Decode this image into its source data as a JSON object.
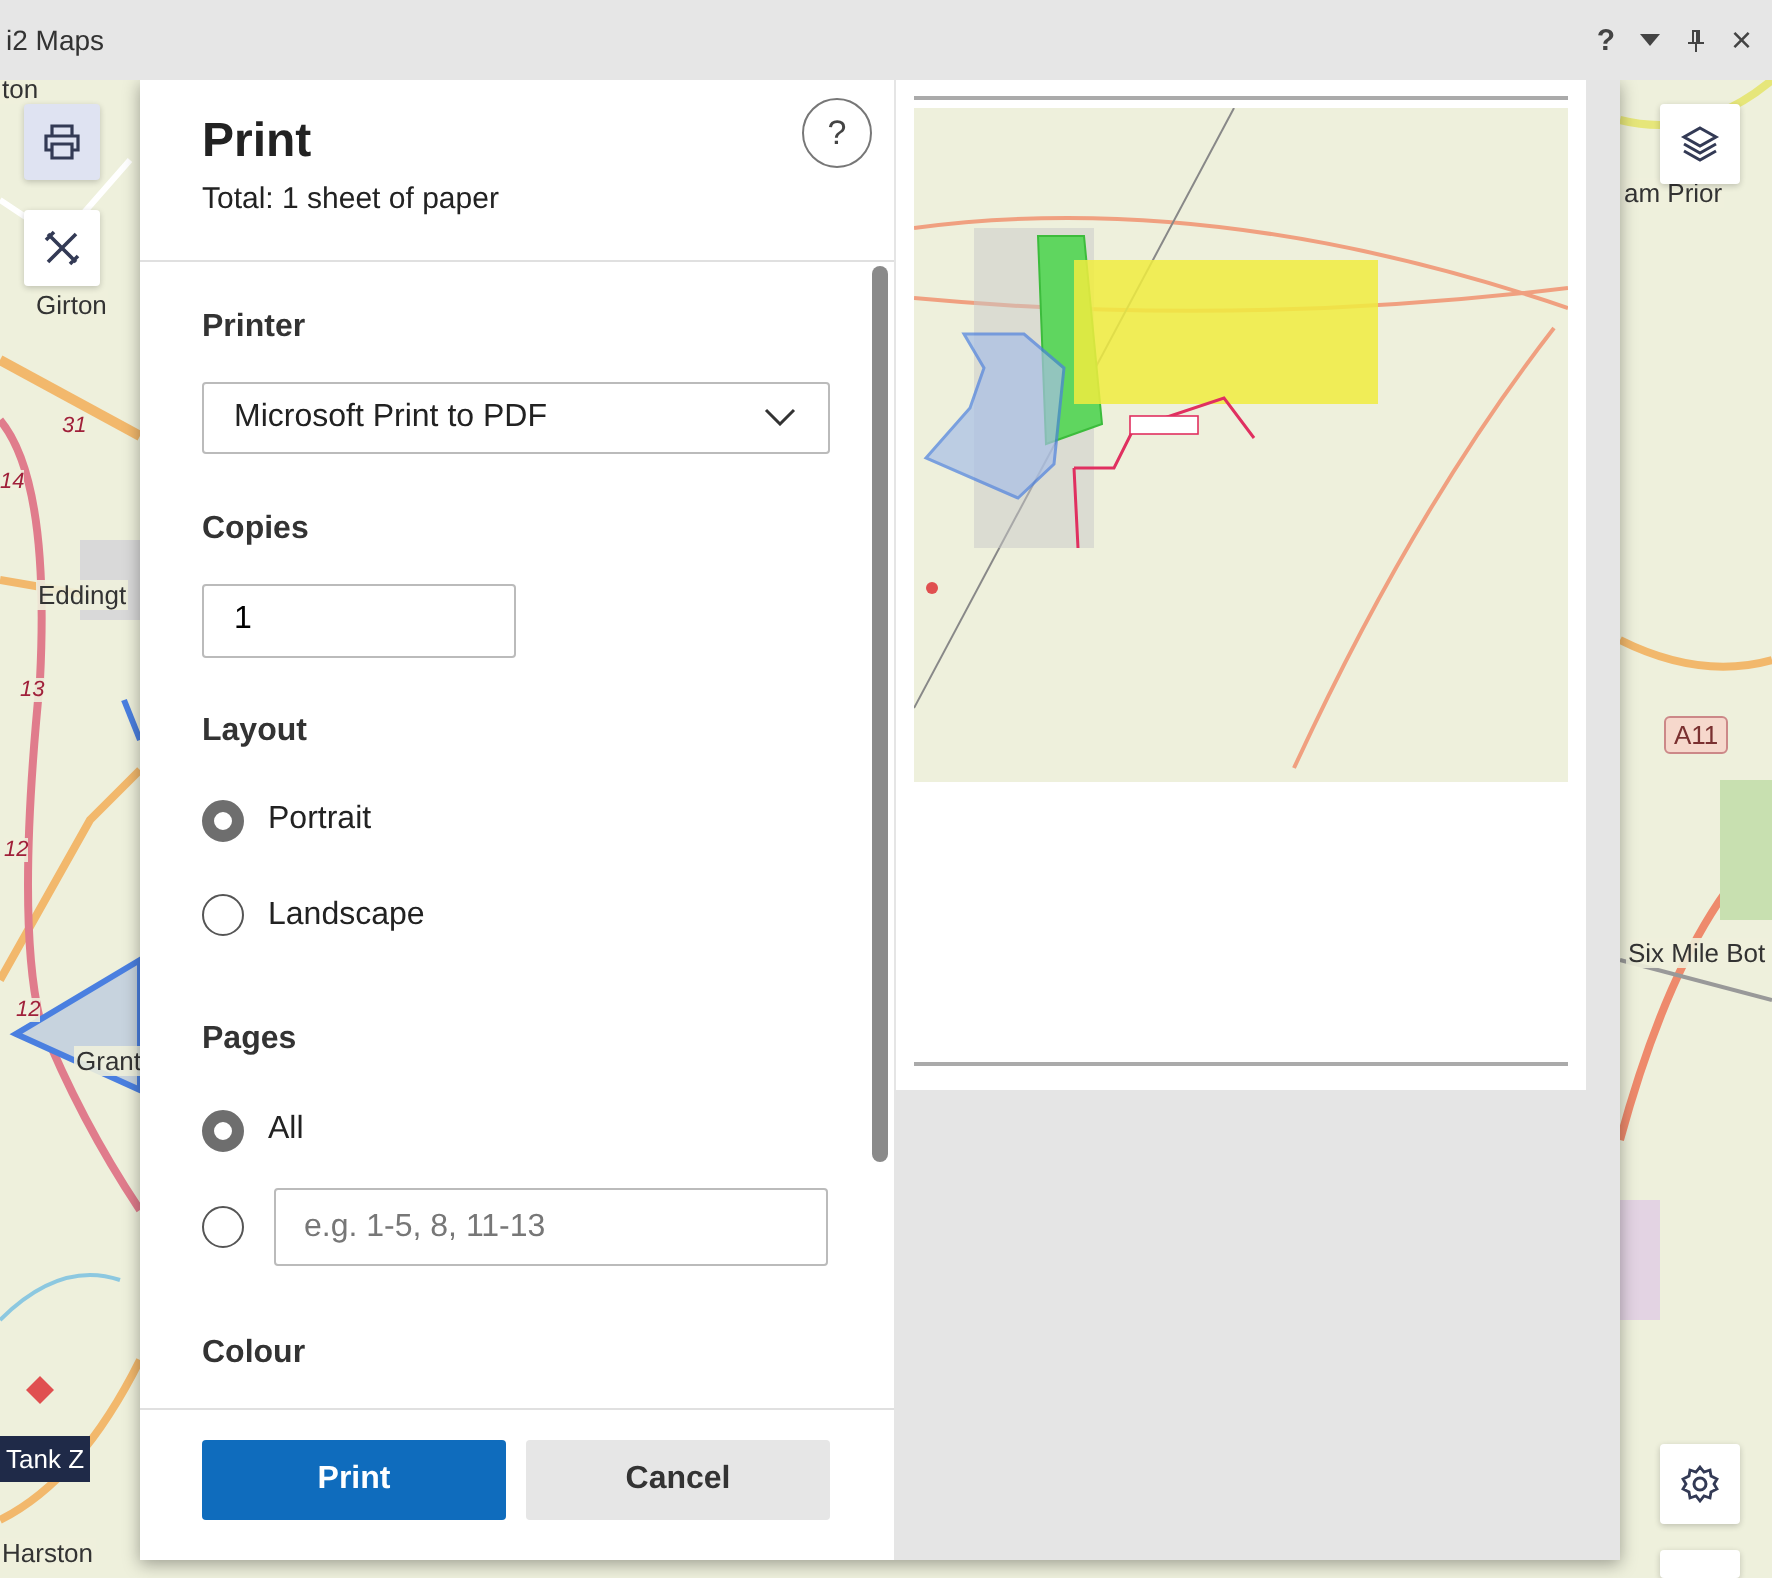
{
  "window": {
    "title": "i2 Maps",
    "help_glyph": "?",
    "close_glyph": "×"
  },
  "map": {
    "places": [
      "ton",
      "Girton",
      "Eddingt",
      "Grant",
      "Harston",
      "am Prior",
      "Six Mile Bot"
    ],
    "road_numbers": [
      "31",
      "14",
      "13",
      "12",
      "12"
    ],
    "road_shield": "A11",
    "marker_label": "Tank Z",
    "tools": [
      {
        "kind": "print",
        "selected": true
      },
      {
        "kind": "measure",
        "selected": false
      }
    ]
  },
  "dialog": {
    "title": "Print",
    "subtitle": "Total: 1 sheet of paper",
    "help_button": "?",
    "printer": {
      "label": "Printer",
      "value": "Microsoft Print to PDF"
    },
    "copies": {
      "label": "Copies",
      "value": "1"
    },
    "layout": {
      "label": "Layout",
      "options": [
        {
          "label": "Portrait",
          "selected": true
        },
        {
          "label": "Landscape",
          "selected": false
        }
      ]
    },
    "pages": {
      "label": "Pages",
      "options": [
        {
          "kind": "label",
          "label": "All",
          "selected": true
        },
        {
          "kind": "range",
          "placeholder": "e.g. 1-5, 8, 11-13",
          "selected": false
        }
      ]
    },
    "colour": {
      "label": "Colour"
    },
    "buttons": [
      {
        "kind": "primary",
        "label": "Print"
      },
      {
        "kind": "secondary",
        "label": "Cancel"
      }
    ]
  }
}
